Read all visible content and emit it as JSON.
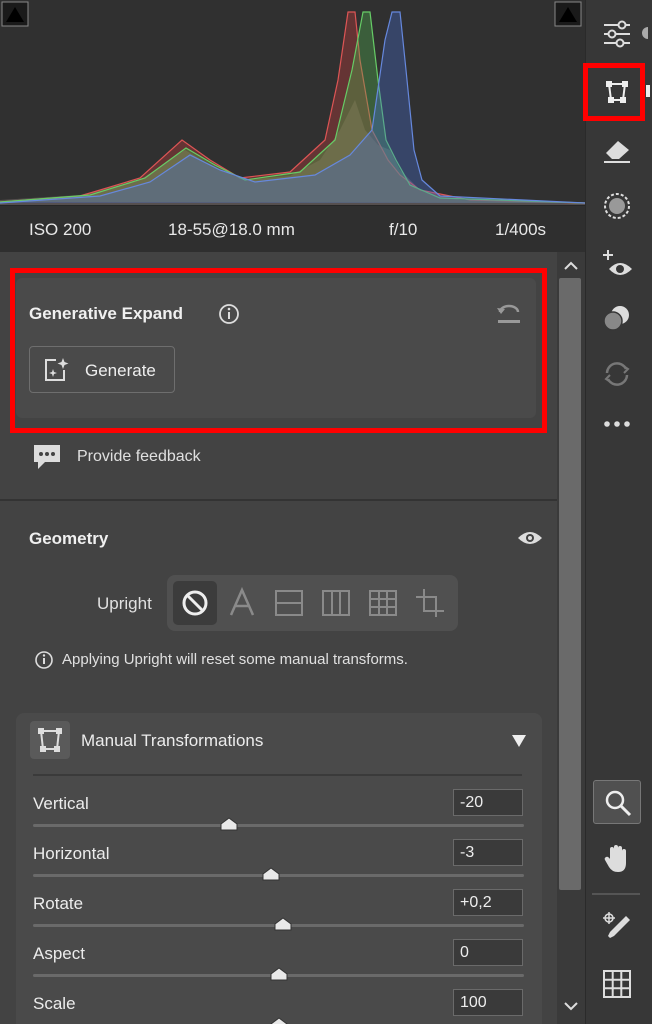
{
  "exif": {
    "iso": "ISO 200",
    "lens": "18-55@18.0 mm",
    "aperture": "f/10",
    "shutter": "1/400s"
  },
  "generative_expand": {
    "title": "Generative Expand",
    "generate_label": "Generate"
  },
  "feedback": {
    "label": "Provide feedback"
  },
  "geometry": {
    "title": "Geometry",
    "upright_label": "Upright",
    "upright_note": "Applying Upright will reset some manual transforms.",
    "upright_modes": [
      "off-icon",
      "auto-icon",
      "level-icon",
      "vertical-icon",
      "full-icon",
      "guided-icon"
    ]
  },
  "manual_transformations": {
    "title": "Manual Transformations",
    "sliders": [
      {
        "label": "Vertical",
        "value": "-20",
        "fraction": 0.4
      },
      {
        "label": "Horizontal",
        "value": "-3",
        "fraction": 0.485
      },
      {
        "label": "Rotate",
        "value": "+0,2",
        "fraction": 0.51
      },
      {
        "label": "Aspect",
        "value": "0",
        "fraction": 0.5
      },
      {
        "label": "Scale",
        "value": "100",
        "fraction": 0.5
      }
    ]
  },
  "toolbar": {
    "tools": [
      "edit-sliders-icon",
      "geometry-icon",
      "remove-eraser-icon",
      "masking-icon",
      "red-eye-icon",
      "presets-icon",
      "sync-icon",
      "more-icon",
      "zoom-icon",
      "hand-icon",
      "color-sampler-icon",
      "grid-icon"
    ],
    "active": "geometry-icon"
  },
  "colors": {
    "highlight": "#ff0000",
    "panel": "#434343",
    "accent_text": "#f0f0f0"
  }
}
